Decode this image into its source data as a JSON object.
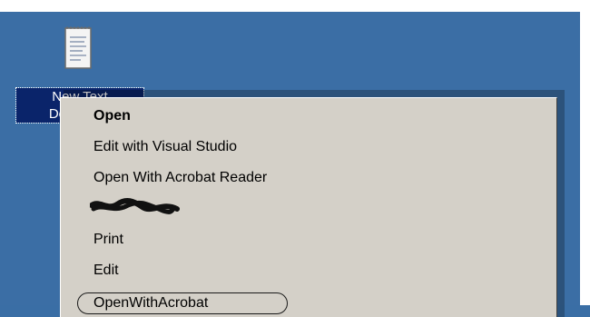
{
  "desktop": {
    "icon_name": "text-document-icon",
    "label_line1": "New Text",
    "label_line2": "Document"
  },
  "context_menu": {
    "items": [
      {
        "label": "Open",
        "bold": true
      },
      {
        "label": "Edit with Visual Studio",
        "bold": false
      },
      {
        "label": "Open With Acrobat Reader",
        "bold": false
      },
      {
        "label": "",
        "bold": false,
        "redacted": true
      },
      {
        "label": "Print",
        "bold": false
      },
      {
        "label": "Edit",
        "bold": false
      },
      {
        "label": "OpenWithAcrobat",
        "bold": false,
        "circled": true
      }
    ]
  },
  "colors": {
    "desktop_background": "#3b6ea5",
    "menu_background": "#d4d0c8",
    "selection": "#0a246a"
  }
}
